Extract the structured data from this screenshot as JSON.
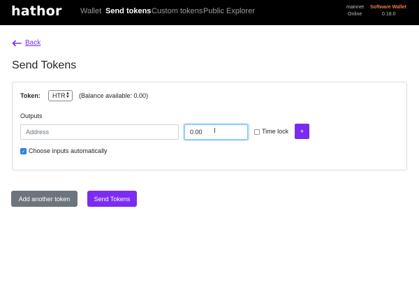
{
  "brand": {
    "logo_text": "hathor"
  },
  "nav": {
    "items": [
      {
        "label": "Wallet",
        "active": false
      },
      {
        "label": "Send tokens",
        "active": true
      },
      {
        "label": "Custom tokens",
        "active": false
      },
      {
        "label": "Public Explorer",
        "active": false
      }
    ]
  },
  "network": {
    "name": "mainnet",
    "status": "Online"
  },
  "wallet": {
    "type": "Software Wallet",
    "version": "0.18.0"
  },
  "back": {
    "label": "Back"
  },
  "page": {
    "title": "Send Tokens"
  },
  "form": {
    "token_label": "Token:",
    "token_selected": "HTR",
    "balance_text": "(Balance available: 0.00)",
    "outputs_label": "Outputs",
    "address_placeholder": "Address",
    "address_value": "",
    "amount_value": "0.00",
    "timelock_label": "Time lock",
    "timelock_checked": false,
    "add_output_label": "+",
    "auto_inputs_label": "Choose inputs automatically",
    "auto_inputs_checked": true
  },
  "actions": {
    "add_token_label": "Add another token",
    "send_label": "Send Tokens"
  },
  "colors": {
    "brand_purple": "#7c2bf1",
    "navbar_bg": "#000000",
    "wallet_type": "#f07b3f",
    "secondary": "#6c757d"
  },
  "icons": {
    "back": "arrow-left-icon",
    "select": "updown-caret-icon",
    "cursor": "text-cursor-icon",
    "check": "check-icon"
  }
}
